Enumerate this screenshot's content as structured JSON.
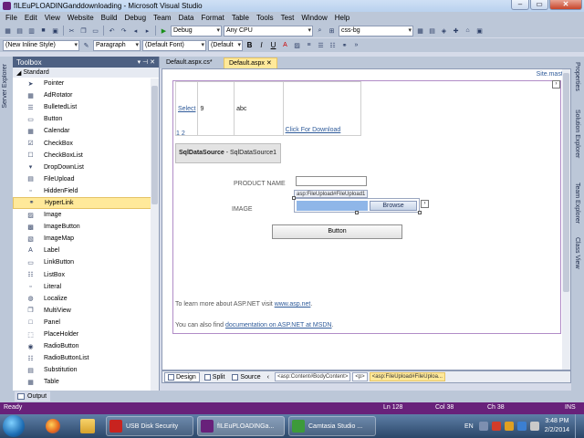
{
  "window": {
    "title": "fILEuPLOADINGanddownloading - Microsoft Visual Studio"
  },
  "menu": [
    "File",
    "Edit",
    "View",
    "Website",
    "Build",
    "Debug",
    "Team",
    "Data",
    "Format",
    "Table",
    "Tools",
    "Test",
    "Window",
    "Help"
  ],
  "toolbar1": {
    "config": "Debug",
    "platform": "Any CPU",
    "css_class": "css-bg"
  },
  "toolbar2": {
    "style": "(New Inline Style)",
    "block": "Paragraph",
    "font": "(Default Font)",
    "size": "(Default",
    "bold": "B",
    "italic": "I",
    "underline": "U"
  },
  "side_left": [
    "Server Explorer"
  ],
  "side_right": [
    "Properties",
    "Solution Explorer",
    "Team Explorer",
    "Class View"
  ],
  "toolbox": {
    "title": "Toolbox",
    "pin": "▾ ⊣ ✕",
    "group": "Standard",
    "items": [
      "Pointer",
      "AdRotator",
      "BulletedList",
      "Button",
      "Calendar",
      "CheckBox",
      "CheckBoxList",
      "DropDownList",
      "FileUpload",
      "HiddenField",
      "HyperLink",
      "Image",
      "ImageButton",
      "ImageMap",
      "Label",
      "LinkButton",
      "ListBox",
      "Literal",
      "Localize",
      "MultiView",
      "Panel",
      "PlaceHolder",
      "RadioButton",
      "RadioButtonList",
      "Substitution",
      "Table"
    ],
    "selected_index": 10
  },
  "doc_tabs": {
    "inactive": "Default.aspx.cs*",
    "active": "Default.aspx"
  },
  "designer": {
    "master_link": "Site.master",
    "grid_row": {
      "select": "Select",
      "num": "9",
      "text": "abc",
      "download": "Click For Download"
    },
    "pager": "1 2",
    "datasource": {
      "type": "SqlDataSource",
      "name": " - SqlDataSource1"
    },
    "product_label": "PRODUCT NAME",
    "fileupload_tag": "asp:FileUpload#FileUpload1",
    "image_label": "IMAGE",
    "browse": "Browse",
    "button": "Button",
    "para1": {
      "text": "To learn more about ASP.NET visit ",
      "link": "www.asp.net",
      "end": "."
    },
    "para2": {
      "text": "You can also find ",
      "link": "documentation on ASP.NET at MSDN",
      "end": "."
    }
  },
  "view_tabs": {
    "design": "Design",
    "split": "Split",
    "source": "Source"
  },
  "breadcrumbs": [
    "<asp:Content#BodyContent>",
    "<p>",
    "<asp:FileUpload#FileUploa..."
  ],
  "output_tab": "Output",
  "status": {
    "left": "Ready",
    "line": "Ln 128",
    "col": "Col 38",
    "ch": "Ch 38",
    "mode": "INS"
  },
  "taskbar": {
    "buttons": [
      "USB Disk Security",
      "fILEuPLOADINGa...",
      "Camtasia Studio ..."
    ],
    "lang": "EN",
    "time": "3:48 PM",
    "date": "2/2/2014"
  }
}
